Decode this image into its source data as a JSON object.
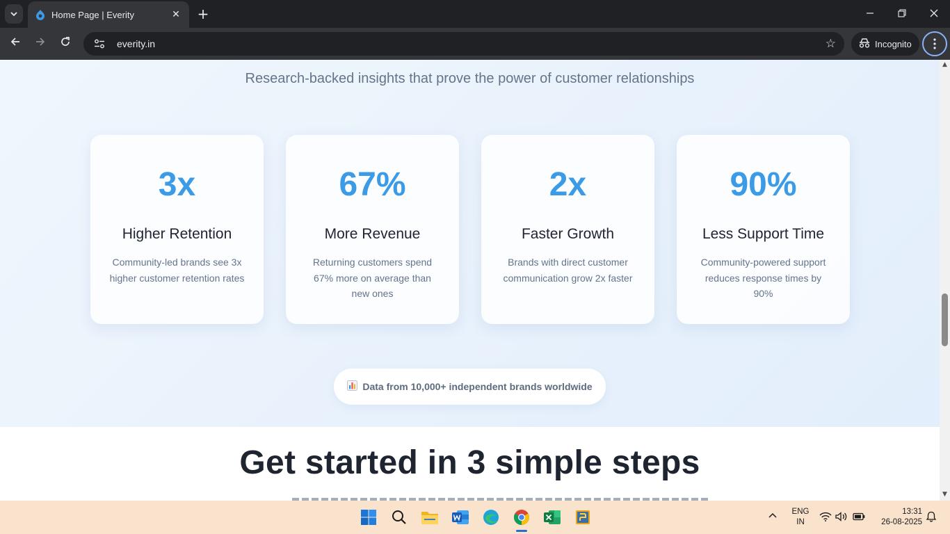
{
  "browser": {
    "tab_title": "Home Page | Everity",
    "url": "everity.in",
    "incognito_label": "Incognito"
  },
  "page": {
    "subtitle": "Research-backed insights that prove the power of customer relationships",
    "stats": [
      {
        "value": "3x",
        "title": "Higher Retention",
        "description": "Community-led brands see 3x higher customer retention rates"
      },
      {
        "value": "67%",
        "title": "More Revenue",
        "description": "Returning customers spend 67% more on average than new ones"
      },
      {
        "value": "2x",
        "title": "Faster Growth",
        "description": "Brands with direct customer communication grow 2x faster"
      },
      {
        "value": "90%",
        "title": "Less Support Time",
        "description": "Community-powered support reduces response times by 90%"
      }
    ],
    "data_note": "Data from 10,000+ independent brands worldwide",
    "steps_heading": "Get started in 3 simple steps"
  },
  "taskbar": {
    "lang_line1": "ENG",
    "lang_line2": "IN",
    "time": "13:31",
    "date": "26-08-2025"
  },
  "colors": {
    "accent": "#3b9be6",
    "heading": "#1e2430",
    "muted": "#64748b"
  }
}
